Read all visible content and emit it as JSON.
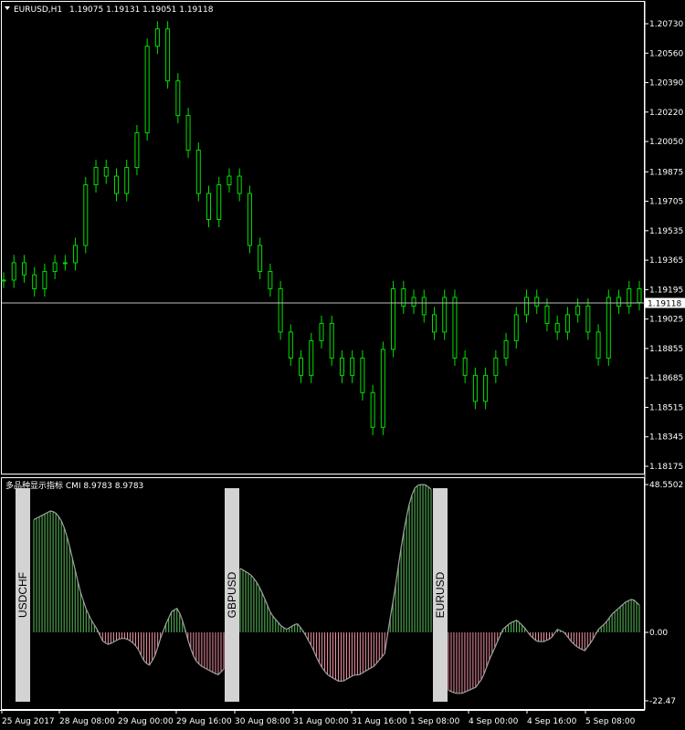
{
  "main_window": {
    "symbol_label": "EURUSD,H1",
    "ohlc_text": "1.19075 1.19131 1.19051 1.19118",
    "current_price": 1.19118,
    "current_price_label": "1.19118",
    "price_scale": [
      "1.20730",
      "1.20560",
      "1.20390",
      "1.20220",
      "1.20050",
      "1.19875",
      "1.19705",
      "1.19535",
      "1.19365",
      "1.19195",
      "1.19025",
      "1.18855",
      "1.18685",
      "1.18515",
      "1.18345",
      "1.18175"
    ],
    "price_range": [
      1.18175,
      1.2073
    ],
    "colors": {
      "bull": "#00e000",
      "bear": "#00e000",
      "bg": "#000000",
      "axis": "#ffffff",
      "price_line": "#c0c0c0"
    }
  },
  "indicator_window": {
    "title": "多品种显示指标 CMI 8.9783 8.9783",
    "scale_labels": [
      "48.5502",
      "0.00",
      "-22.47"
    ],
    "scale_range": [
      -22.47,
      48.5502
    ],
    "colors": {
      "positive": "#5ec25e",
      "negative": "#f08fa0",
      "line": "#a0a0a0",
      "label_bg": "#d3d3d3"
    },
    "symbol_labels": [
      "USDCHF",
      "GBPUSD",
      "EURUSD"
    ]
  },
  "time_axis": {
    "labels": [
      "25 Aug 2017",
      "28 Aug 08:00",
      "29 Aug 00:00",
      "29 Aug 16:00",
      "30 Aug 08:00",
      "31 Aug 00:00",
      "31 Aug 16:00",
      "1 Sep 08:00",
      "4 Sep 00:00",
      "4 Sep 16:00",
      "5 Sep 08:00"
    ]
  },
  "chart_data": {
    "type": "candlestick",
    "main": {
      "symbol": "EURUSD",
      "timeframe": "H1",
      "close_approx": [
        1.1925,
        1.1935,
        1.1928,
        1.192,
        1.193,
        1.1935,
        1.1935,
        1.1945,
        1.198,
        1.199,
        1.1985,
        1.1975,
        1.199,
        1.201,
        1.206,
        1.207,
        1.204,
        1.202,
        1.2,
        1.1975,
        1.196,
        1.198,
        1.1985,
        1.1975,
        1.1945,
        1.193,
        1.192,
        1.1895,
        1.188,
        1.187,
        1.189,
        1.19,
        1.188,
        1.187,
        1.188,
        1.186,
        1.184,
        1.1885,
        1.192,
        1.191,
        1.1915,
        1.1905,
        1.1895,
        1.1915,
        1.188,
        1.187,
        1.1855,
        1.187,
        1.188,
        1.189,
        1.1905,
        1.1915,
        1.191,
        1.19,
        1.1895,
        1.1905,
        1.191,
        1.1895,
        1.188,
        1.1915,
        1.191,
        1.192,
        1.1912
      ]
    },
    "indicator": {
      "name": "CMI",
      "segments": [
        {
          "symbol": "USDCHF",
          "values": [
            37,
            38,
            39,
            40,
            39,
            36,
            30,
            22,
            14,
            8,
            4,
            1,
            -3,
            -4,
            -3,
            -2,
            -2,
            -3,
            -5,
            -9,
            -11,
            -8,
            -2,
            3,
            7,
            8,
            3,
            -4,
            -9,
            -11,
            -12,
            -13,
            -14,
            -12
          ]
        },
        {
          "symbol": "GBPUSD",
          "values": [
            21,
            20,
            19,
            17,
            14,
            10,
            6,
            4,
            2,
            1,
            2,
            3,
            1,
            -2,
            -5,
            -9,
            -12,
            -14,
            -15,
            -16,
            -16,
            -15,
            -14,
            -14,
            -13,
            -12,
            -11,
            -9,
            -7,
            4,
            14,
            26,
            36,
            44,
            48,
            48.6,
            48.4,
            47
          ]
        },
        {
          "symbol": "EURUSD",
          "values": [
            -19,
            -20,
            -20,
            -19,
            -18,
            -15,
            -9,
            -4,
            1,
            3,
            4,
            2,
            -1,
            -3,
            -3,
            -2,
            1,
            0,
            -3,
            -5,
            -6,
            -3,
            1,
            3,
            6,
            8,
            10,
            11,
            9
          ]
        }
      ]
    }
  }
}
